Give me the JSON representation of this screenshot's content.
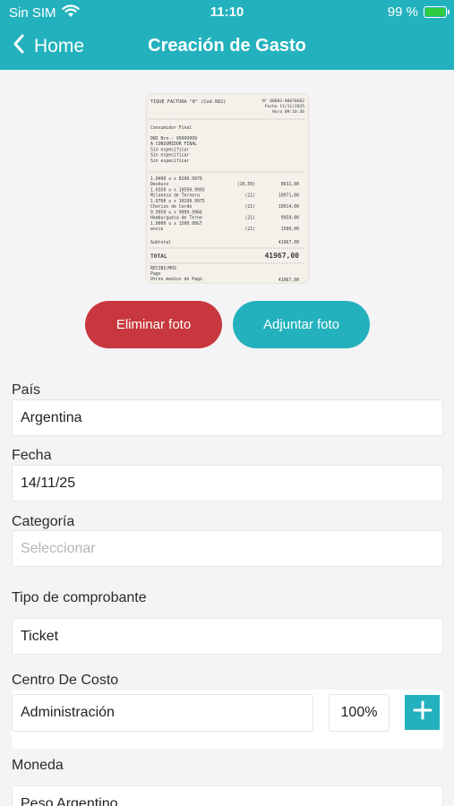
{
  "status_bar": {
    "carrier": "Sin SIM",
    "time": "11:10",
    "battery": "99 %"
  },
  "nav": {
    "back_label": "Home",
    "title": "Creación de Gasto"
  },
  "receipt": {
    "header_left": "TIQUE FACTURA \"B\" (Cod.082)",
    "header_right": "N° 00002-00070682",
    "date_line": "Fecha 11/11/2025",
    "hour_line": "Hora 09:10:36",
    "customer_lines": [
      "Consumidor Final",
      "DNI Nro.: 99999999",
      "A CONSUMIDOR FINAL",
      "Sin especificar",
      "Sin especificar",
      "Sin especificar"
    ],
    "items": [
      {
        "qty": "1.0400 u x 8299.9976",
        "name": "Desbuco",
        "tax": "(10,50)",
        "amount": "8632,00"
      },
      {
        "qty": "1.0350 u x 10599.9993",
        "name": "Milanesa de Ternera",
        "tax": "(21)",
        "amount": "10971,00"
      },
      {
        "qty": "1.0700 u x 10199.9975",
        "name": "Chorizo de Cerdo",
        "tax": "(21)",
        "amount": "10914,00"
      },
      {
        "qty": "0.9950 u x 9999.9966",
        "name": "Hamburguesa de Terne",
        "tax": "(21)",
        "amount": "9950,00"
      },
      {
        "qty": "1.0000 u x 1500.00GT",
        "name": "envio",
        "tax": "(21)",
        "amount": "1500,00"
      }
    ],
    "subtotal_label": "Subtotal",
    "subtotal": "41967,00",
    "total_label": "TOTAL",
    "total": "41967,00",
    "footer_lines": [
      "RECIBI/MOS",
      "Pago",
      "Otros medios de Pago"
    ],
    "footer_amount": "41967,00"
  },
  "photo_actions": {
    "delete_label": "Eliminar foto",
    "attach_label": "Adjuntar foto"
  },
  "form": {
    "country": {
      "label": "País",
      "value": "Argentina"
    },
    "date": {
      "label": "Fecha",
      "value": "14/11/25"
    },
    "category": {
      "label": "Categoría",
      "placeholder": "Seleccionar"
    },
    "receipt_type": {
      "label": "Tipo de comprobante",
      "value": "Ticket"
    },
    "cost_center": {
      "label": "Centro De Costo",
      "name": "Administración",
      "percent": "100%"
    },
    "currency": {
      "label": "Moneda",
      "value": "Peso Argentino"
    }
  },
  "colors": {
    "primary": "#23b2bd",
    "danger": "#c7373d",
    "battery": "#2ecc40"
  },
  "icons": {
    "back": "chevron-left-icon",
    "wifi": "wifi-icon",
    "add": "plus-icon"
  }
}
